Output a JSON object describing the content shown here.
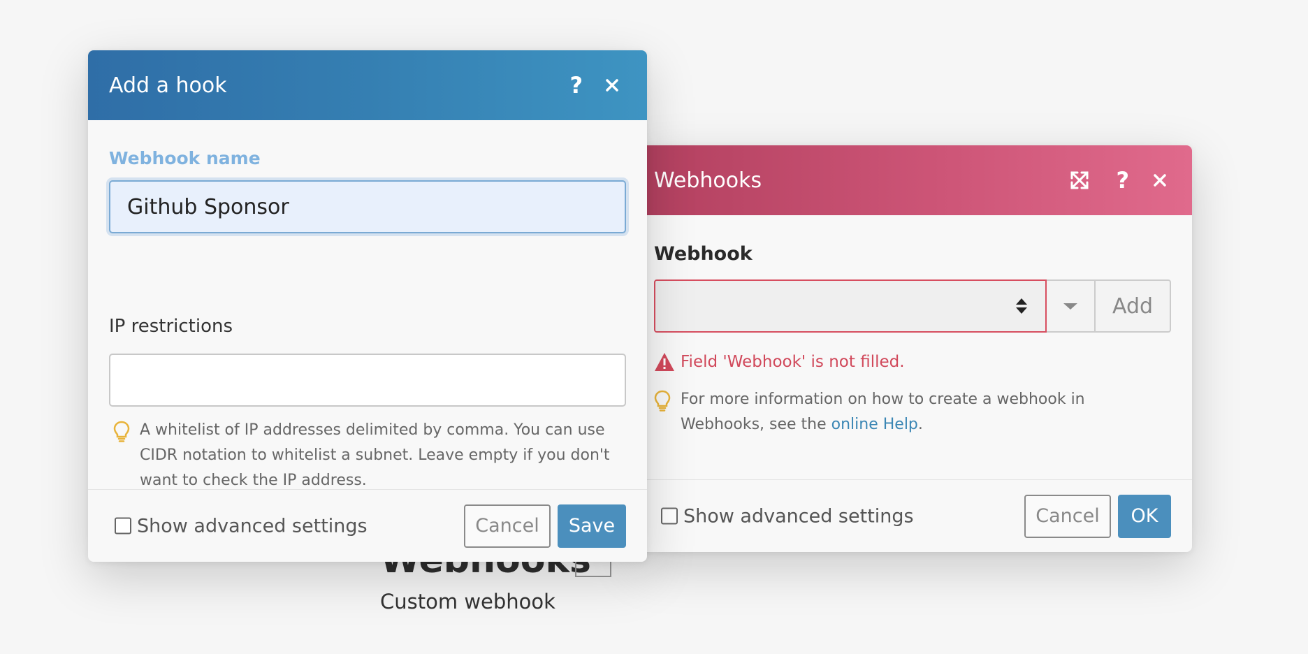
{
  "background_module": {
    "title": "Webhooks",
    "subtitle": "Custom webhook"
  },
  "webhooks_dialog": {
    "title": "Webhooks",
    "field_label": "Webhook",
    "add_button": "Add",
    "error": "Field 'Webhook' is not filled.",
    "hint_prefix": "For more information on how to create a webhook in Webhooks, see the ",
    "hint_link": "online Help",
    "hint_suffix": ".",
    "advanced_label": "Show advanced settings",
    "cancel_button": "Cancel",
    "ok_button": "OK",
    "header_color": "#c84f71",
    "error_color": "#d1495b"
  },
  "hook_dialog": {
    "title": "Add a hook",
    "name_label": "Webhook name",
    "name_value": "Github Sponsor",
    "ip_label": "IP restrictions",
    "ip_value": "",
    "ip_hint": "A whitelist of IP addresses delimited by comma. You can use CIDR notation to whitelist a subnet. Leave empty if you don't want to check the IP address.",
    "advanced_label": "Show advanced settings",
    "cancel_button": "Cancel",
    "save_button": "Save",
    "header_color": "#357fb2",
    "primary_color": "#4b8fbd"
  }
}
